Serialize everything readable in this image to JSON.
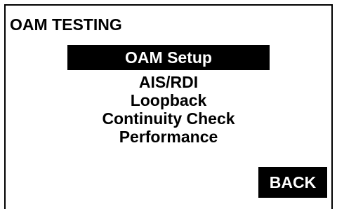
{
  "screen": {
    "title": "OAM TESTING"
  },
  "menu": {
    "items": [
      {
        "label": "OAM Setup",
        "selected": true
      },
      {
        "label": "AIS/RDI",
        "selected": false
      },
      {
        "label": "Loopback",
        "selected": false
      },
      {
        "label": "Continuity Check",
        "selected": false
      },
      {
        "label": "Performance",
        "selected": false
      }
    ]
  },
  "footer": {
    "back_label": "BACK"
  }
}
